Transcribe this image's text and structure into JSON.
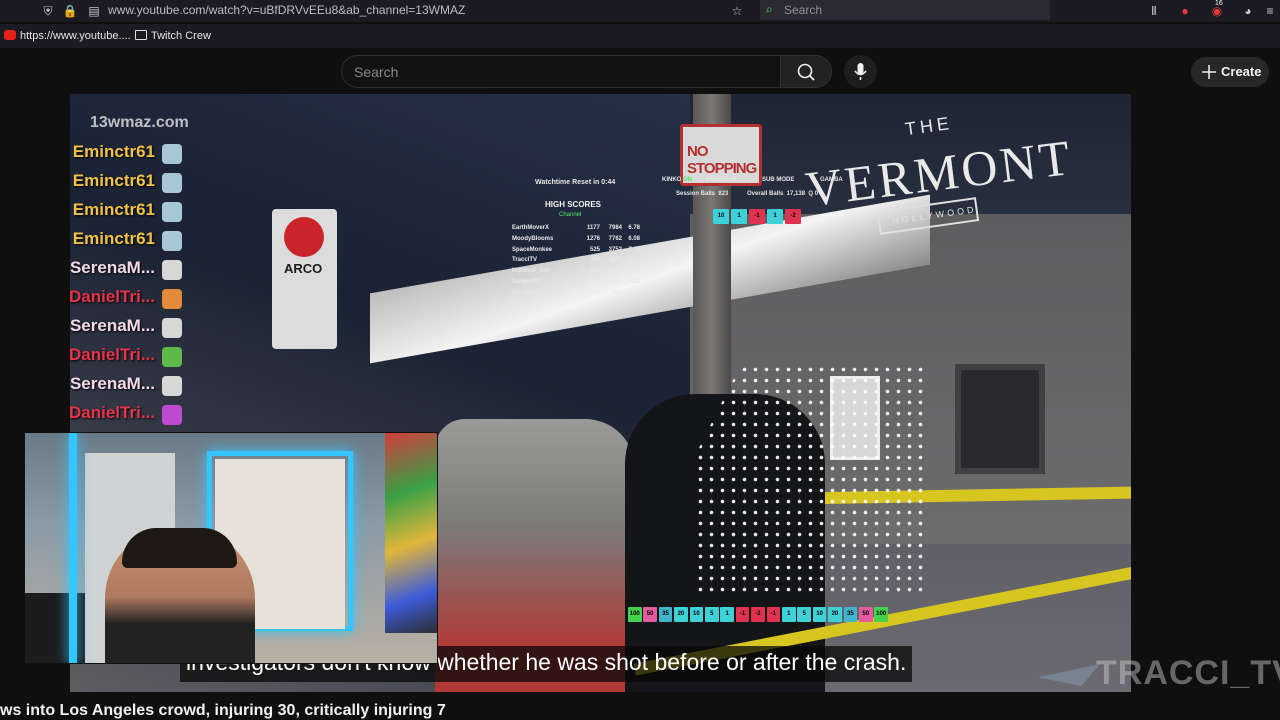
{
  "browser": {
    "url": "www.youtube.com/watch?v=uBfDRVvEEu8&ab_channel=13WMAZ",
    "search_placeholder": "Search",
    "bookmarks": [
      {
        "label": "https://www.youtube...."
      },
      {
        "label": "Twitch Crew"
      }
    ],
    "notification_badge": "16"
  },
  "youtube": {
    "search_placeholder": "Search",
    "create_label": "Create"
  },
  "video": {
    "station_watermark": "13wmaz.com",
    "caption": "investigators don't know whether he was shot before or after the crash.",
    "signs": {
      "no_stopping": "NO STOPPING",
      "the": "THE",
      "vermont": "VERMONT",
      "hollywood": "HOLLYWOOD",
      "arco": "ARCO"
    },
    "title": "ws into Los Angeles crowd, injuring 30, critically injuring 7"
  },
  "overlay": {
    "chat": [
      {
        "name": "Eminctr61",
        "color": "#f0c24a",
        "emote_color": "#a9c6d6"
      },
      {
        "name": "Eminctr61",
        "color": "#f0c24a",
        "emote_color": "#a9c6d6"
      },
      {
        "name": "Eminctr61",
        "color": "#f0c24a",
        "emote_color": "#a9c6d6"
      },
      {
        "name": "Eminctr61",
        "color": "#f0c24a",
        "emote_color": "#a9c6d6"
      },
      {
        "name": "SerenaM...",
        "color": "#f3d9e8",
        "emote_color": "#d7d7d7"
      },
      {
        "name": "DanielTri...",
        "color": "#e8334a",
        "emote_color": "#e28b3a"
      },
      {
        "name": "SerenaM...",
        "color": "#f3d9e8",
        "emote_color": "#d7d7d7"
      },
      {
        "name": "DanielTri...",
        "color": "#e8334a",
        "emote_color": "#5fb84a"
      },
      {
        "name": "SerenaM...",
        "color": "#f3d9e8",
        "emote_color": "#d7d7d7"
      },
      {
        "name": "DanielTri...",
        "color": "#e8334a",
        "emote_color": "#c04ad0"
      }
    ],
    "watchtime_reset": "Watchtime Reset in 0:44",
    "high_scores_title": "HIGH SCORES",
    "high_scores_channel": "Channel",
    "high_scores": [
      {
        "name": "EarthMoverX",
        "a": "1177",
        "b": "7984",
        "c": "6.78"
      },
      {
        "name": "MoodyBlooms",
        "a": "1276",
        "b": "7762",
        "c": "6.08"
      },
      {
        "name": "SpaceMonkee",
        "a": "525",
        "b": "3752",
        "c": "7.15"
      },
      {
        "name": "TracciTV",
        "a": "389",
        "b": "2531",
        "c": "6.51"
      },
      {
        "name": "Notional_Zen",
        "a": "242",
        "b": "1298",
        "c": "5.36"
      },
      {
        "name": "famguy99",
        "a": "190",
        "b": "1104",
        "c": "5.81"
      },
      {
        "name": "BassMom",
        "a": "122",
        "b": "914",
        "c": "7.49"
      },
      {
        "name": "Arke_c",
        "a": "",
        "b": "",
        "c": ""
      }
    ],
    "status": {
      "kinko": "KINKO",
      "kinko_state": "ON",
      "freeplay": "FREEPLAY",
      "sub_mode": "SUB MODE",
      "gamba": "GAMBA",
      "session_balls_label": "Session Balls",
      "session_balls": "823",
      "overall_balls_label": "Overall Balls",
      "overall_balls": "17,138",
      "q_label": "Q",
      "q_value": "0"
    },
    "top_chips": [
      {
        "label": "10",
        "color": "#3fd1d8"
      },
      {
        "label": "1",
        "color": "#3fd1d8"
      },
      {
        "label": "-1",
        "color": "#e0334f"
      },
      {
        "label": "1",
        "color": "#3fd1d8"
      },
      {
        "label": "-2",
        "color": "#e0334f"
      }
    ],
    "bottom_chips": [
      {
        "label": "100",
        "color": "#45d34e"
      },
      {
        "label": "50",
        "color": "#e35a9e"
      },
      {
        "label": "35",
        "color": "#3fb6c9"
      },
      {
        "label": "20",
        "color": "#3fd1d8"
      },
      {
        "label": "10",
        "color": "#3fd1d8"
      },
      {
        "label": "5",
        "color": "#3fd1d8"
      },
      {
        "label": "1",
        "color": "#3fd1d8"
      },
      {
        "label": "-1",
        "color": "#e0334f"
      },
      {
        "label": "-2",
        "color": "#e0334f"
      },
      {
        "label": "-1",
        "color": "#e0334f"
      },
      {
        "label": "1",
        "color": "#3fd1d8"
      },
      {
        "label": "5",
        "color": "#3fd1d8"
      },
      {
        "label": "10",
        "color": "#3fd1d8"
      },
      {
        "label": "20",
        "color": "#3fd1d8"
      },
      {
        "label": "35",
        "color": "#3fb6c9"
      },
      {
        "label": "50",
        "color": "#e35a9e"
      },
      {
        "label": "100",
        "color": "#45d34e"
      }
    ],
    "streamer_watermark": "TRACCI_TV"
  }
}
